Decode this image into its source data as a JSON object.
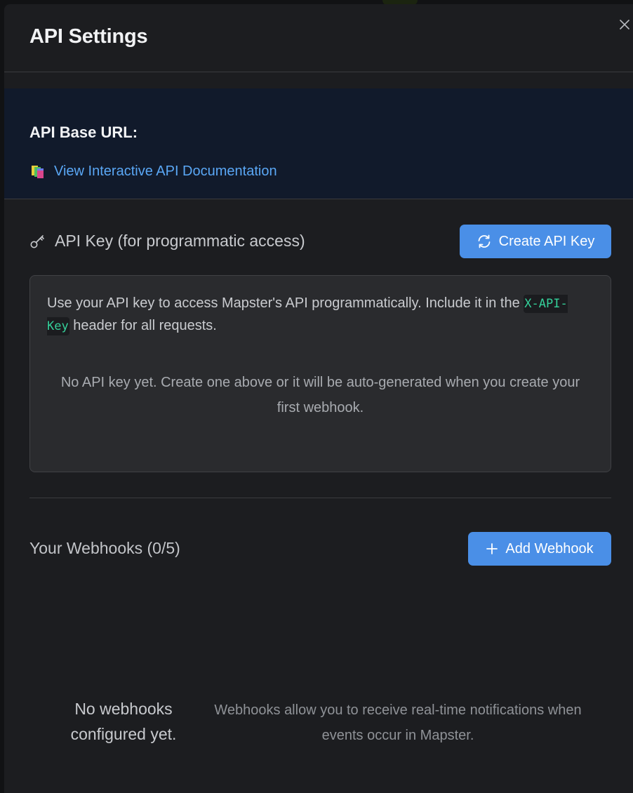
{
  "modal": {
    "title": "API Settings",
    "close_icon": "close-icon"
  },
  "base_url": {
    "label": "API Base URL:",
    "docs_link": "View Interactive API Documentation",
    "docs_icon": "books-icon"
  },
  "api_key": {
    "heading": "API Key (for programmatic access)",
    "heading_icon": "key-icon",
    "create_button": "Create API Key",
    "create_icon": "refresh-icon",
    "info_prefix": "Use your API key to access Mapster's API programmatically. Include it in the ",
    "header_name": "X-API-Key",
    "info_suffix": " header for all requests.",
    "empty_message": "No API key yet. Create one above or it will be auto-generated when you create your first webhook."
  },
  "webhooks": {
    "heading": "Your Webhooks (0/5)",
    "add_button": "Add Webhook",
    "add_icon": "plus-icon",
    "empty_title": "No webhooks configured yet.",
    "empty_description": "Webhooks allow you to receive real-time notifications when events occur in Mapster."
  },
  "colors": {
    "accent": "#4a8fe7",
    "link": "#5aa7f5",
    "code": "#35d09a",
    "modal_bg": "#1c1d20",
    "banner_bg": "#111a2b"
  }
}
